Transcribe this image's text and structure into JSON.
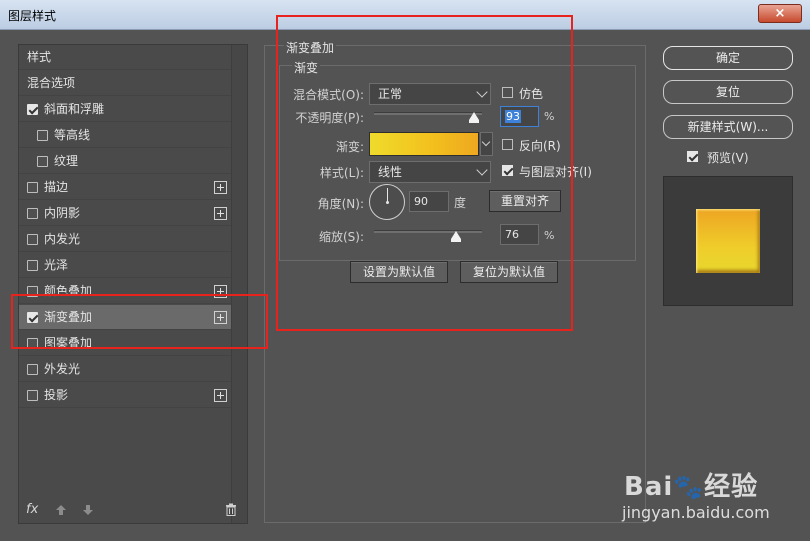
{
  "window": {
    "title": "图层样式",
    "close_label": "×"
  },
  "sidebar": {
    "header": "样式",
    "items": [
      {
        "label": "混合选项",
        "checkbox": false,
        "checked": false,
        "plus": false,
        "indent": false,
        "active": false
      },
      {
        "label": "斜面和浮雕",
        "checkbox": true,
        "checked": true,
        "plus": false,
        "indent": false,
        "active": false
      },
      {
        "label": "等高线",
        "checkbox": true,
        "checked": false,
        "plus": false,
        "indent": true,
        "active": false
      },
      {
        "label": "纹理",
        "checkbox": true,
        "checked": false,
        "plus": false,
        "indent": true,
        "active": false
      },
      {
        "label": "描边",
        "checkbox": true,
        "checked": false,
        "plus": true,
        "indent": false,
        "active": false
      },
      {
        "label": "内阴影",
        "checkbox": true,
        "checked": false,
        "plus": true,
        "indent": false,
        "active": false
      },
      {
        "label": "内发光",
        "checkbox": true,
        "checked": false,
        "plus": false,
        "indent": false,
        "active": false
      },
      {
        "label": "光泽",
        "checkbox": true,
        "checked": false,
        "plus": false,
        "indent": false,
        "active": false
      },
      {
        "label": "颜色叠加",
        "checkbox": true,
        "checked": false,
        "plus": true,
        "indent": false,
        "active": false
      },
      {
        "label": "渐变叠加",
        "checkbox": true,
        "checked": true,
        "plus": true,
        "indent": false,
        "active": true
      },
      {
        "label": "图案叠加",
        "checkbox": true,
        "checked": false,
        "plus": false,
        "indent": false,
        "active": false
      },
      {
        "label": "外发光",
        "checkbox": true,
        "checked": false,
        "plus": false,
        "indent": false,
        "active": false
      },
      {
        "label": "投影",
        "checkbox": true,
        "checked": false,
        "plus": true,
        "indent": false,
        "active": false
      }
    ],
    "footer": {
      "fx_label": "fx",
      "up_icon": "arrow-up-icon",
      "down_icon": "arrow-down-icon",
      "delete_icon": "trash-icon"
    }
  },
  "panel": {
    "group_title": "渐变叠加",
    "sub_title": "渐变",
    "blend_mode_label": "混合模式(O):",
    "blend_mode_value": "正常",
    "dither_label": "仿色",
    "dither_checked": false,
    "opacity_label": "不透明度(P):",
    "opacity_value": "93",
    "opacity_unit": "%",
    "opacity_level": 93,
    "gradient_label": "渐变:",
    "gradient_colors": [
      "#efdb2c",
      "#f3c11d",
      "#eea820"
    ],
    "reverse_label": "反向(R)",
    "reverse_checked": false,
    "style_label": "样式(L):",
    "style_value": "线性",
    "align_label": "与图层对齐(I)",
    "align_checked": true,
    "angle_label": "角度(N):",
    "angle_value": "90",
    "angle_unit": "度",
    "reset_align_label": "重置对齐",
    "scale_label": "缩放(S):",
    "scale_value": "76",
    "scale_unit": "%",
    "scale_level": 76,
    "make_default_label": "设置为默认值",
    "reset_default_label": "复位为默认值"
  },
  "actions": {
    "ok_label": "确定",
    "reset_label": "复位",
    "new_style_label": "新建样式(W)...",
    "preview_label": "预览(V)",
    "preview_checked": true
  },
  "watermark": {
    "brand": "Bai",
    "brand2": "经验",
    "url": "jingyan.baidu.com"
  },
  "colors": {
    "annotation": "#e8231d",
    "accent": "#3d82d8"
  }
}
